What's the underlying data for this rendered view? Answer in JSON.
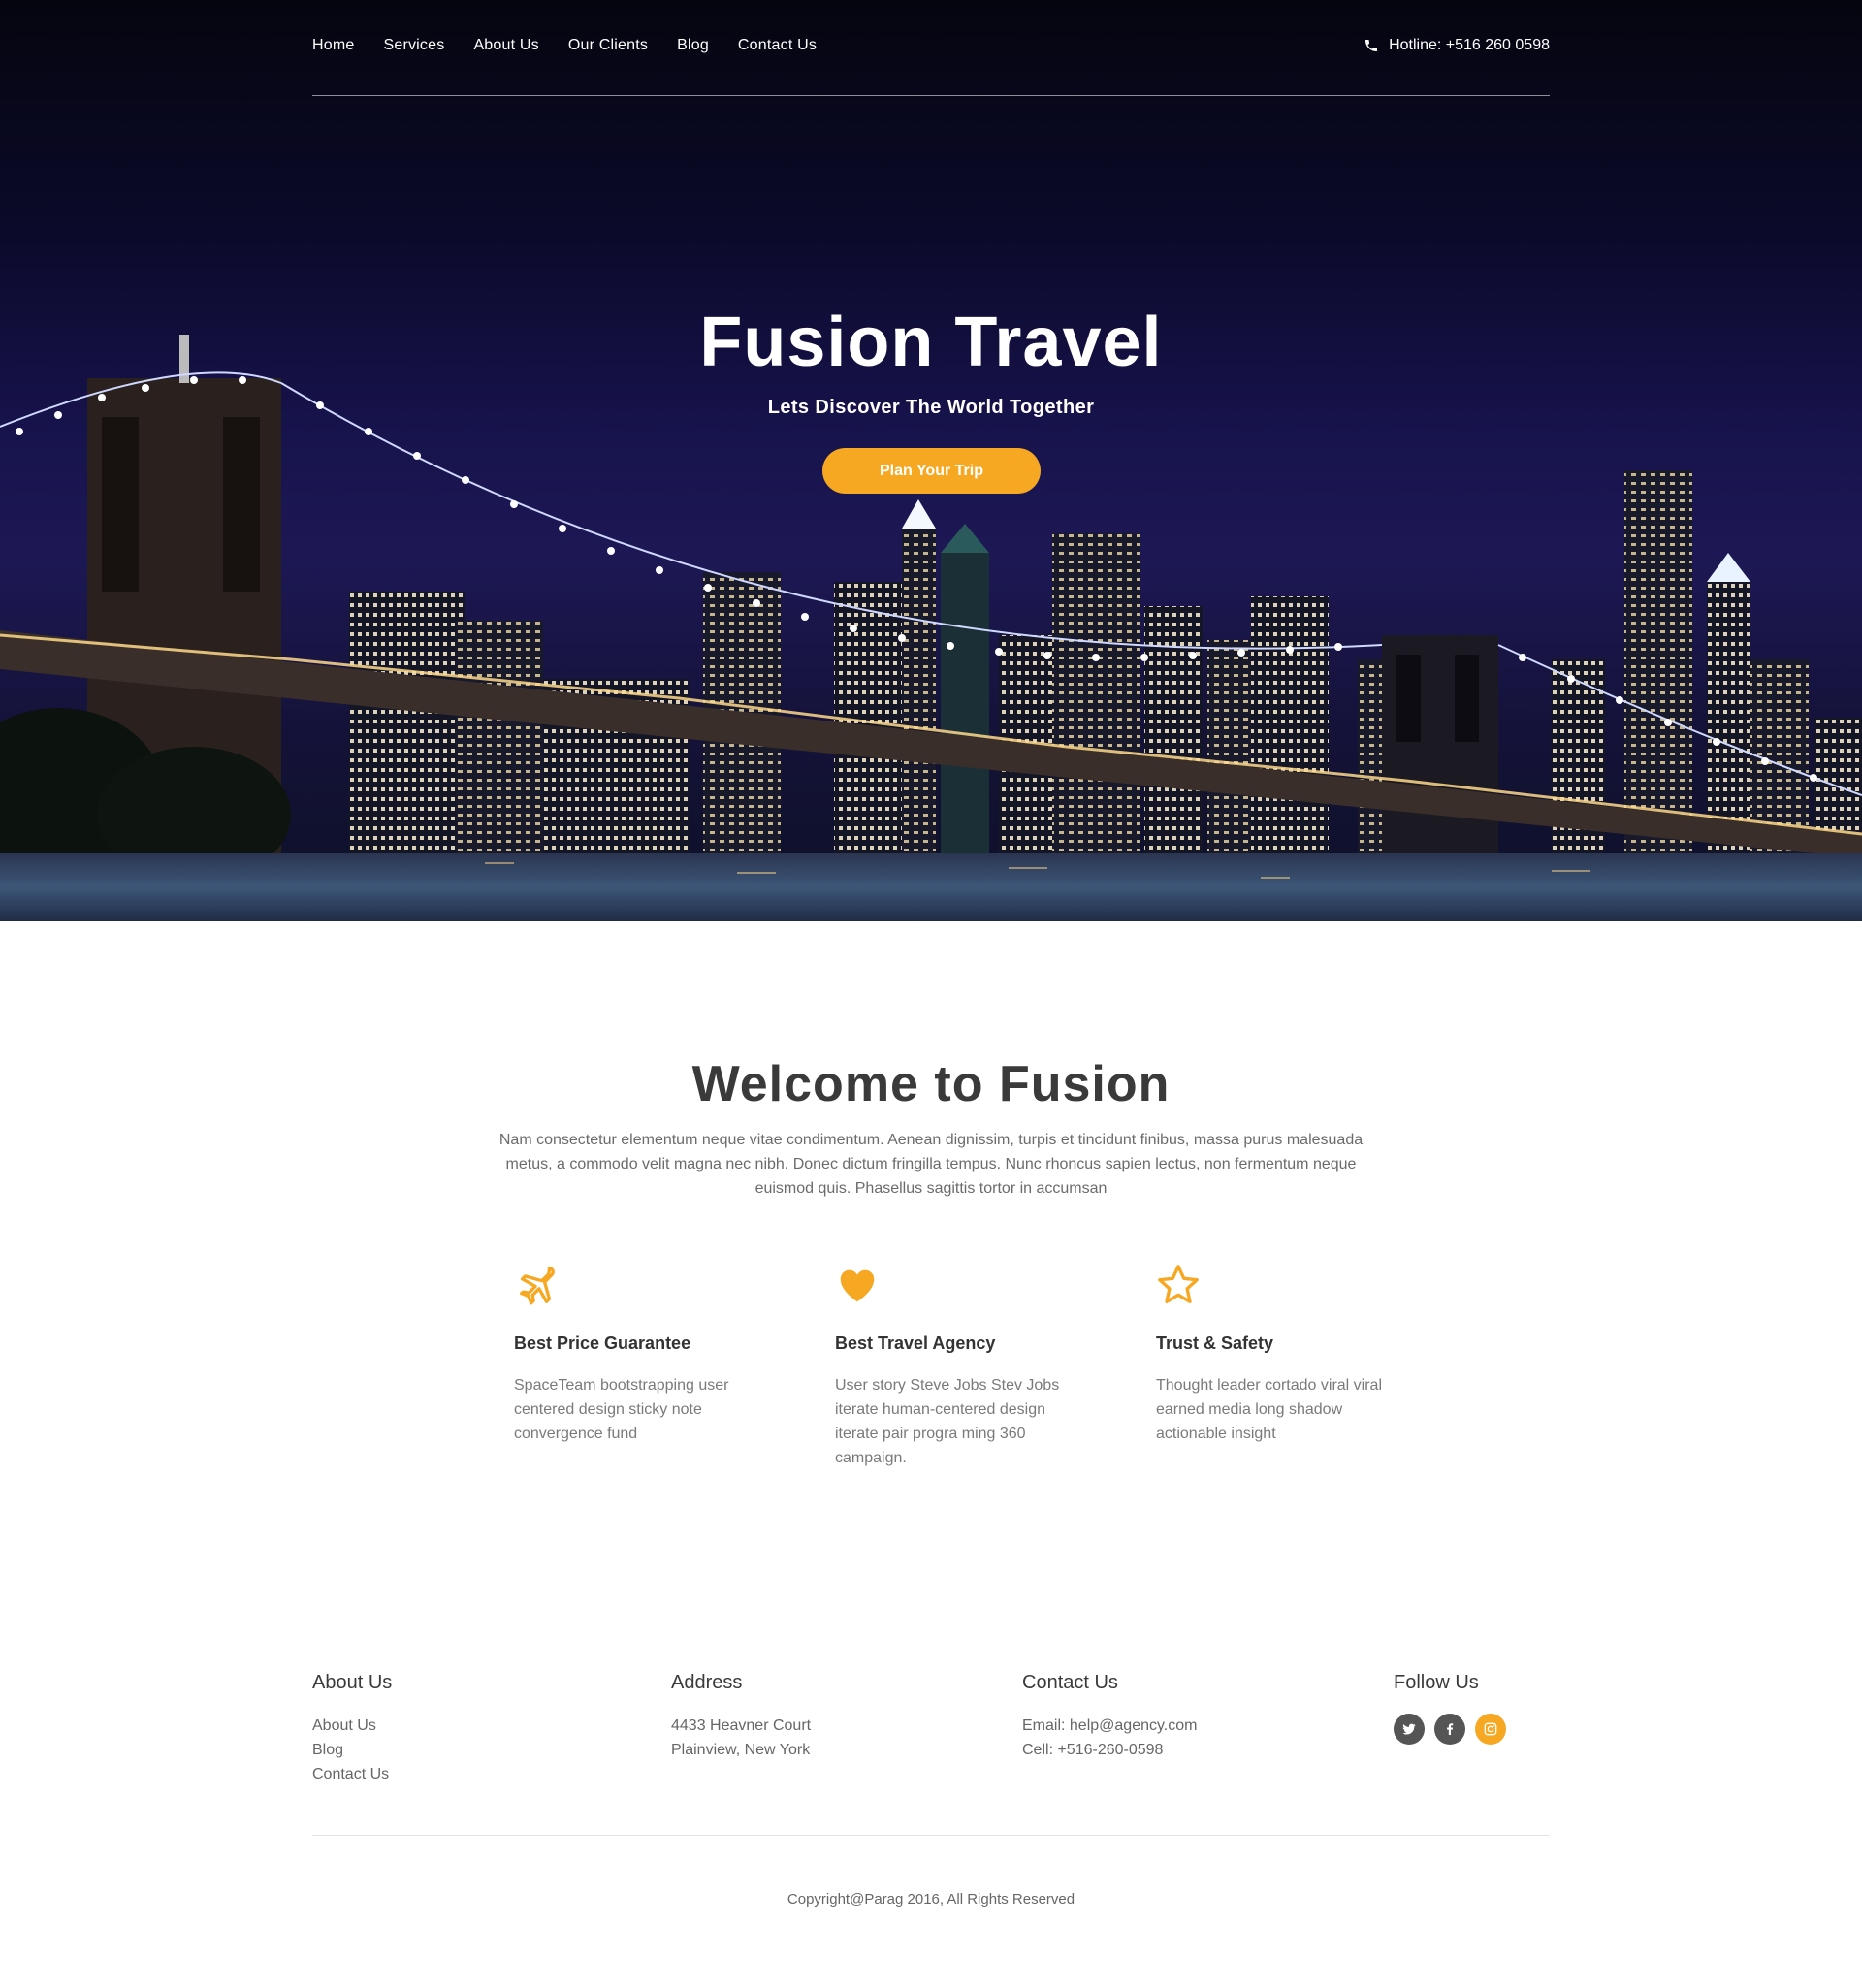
{
  "nav": {
    "items": [
      "Home",
      "Services",
      "About Us",
      "Our Clients",
      "Blog",
      "Contact Us"
    ],
    "hotline": "Hotline: +516 260 0598",
    "hotline_icon": "phone-icon"
  },
  "hero": {
    "title": "Fusion Travel",
    "subtitle": "Lets Discover The World Together",
    "cta": "Plan Your Trip"
  },
  "welcome": {
    "title": "Welcome to Fusion",
    "text": "Nam consectetur elementum neque vitae condimentum. Aenean dignissim, turpis et tincidunt finibus, massa purus malesuada metus, a commodo velit magna nec nibh. Donec dictum fringilla tempus. Nunc rhoncus sapien lectus, non fermentum neque euismod quis. Phasellus sagittis tortor in accumsan"
  },
  "features": [
    {
      "icon": "airplane-icon",
      "title": "Best Price Guarantee",
      "text": "SpaceTeam bootstrapping user centered design sticky note convergence fund"
    },
    {
      "icon": "heart-icon",
      "title": "Best Travel Agency",
      "text": "User story Steve Jobs Stev Jobs iterate human-centered design iterate pair progra ming 360 campaign."
    },
    {
      "icon": "star-icon",
      "title": "Trust & Safety",
      "text": "Thought leader cortado viral viral earned media long shadow actionable insight"
    }
  ],
  "footer": {
    "about": {
      "title": "About Us",
      "links": [
        "About Us",
        "Blog",
        "Contact Us"
      ]
    },
    "address": {
      "title": "Address",
      "lines": [
        "4433 Heavner Court",
        "Plainview, New York"
      ]
    },
    "contact": {
      "title": "Contact Us",
      "lines": [
        "Email: help@agency.com",
        "Cell: +516-260-0598"
      ]
    },
    "follow": {
      "title": "Follow Us",
      "icons": [
        "twitter-icon",
        "facebook-icon",
        "instagram-icon"
      ]
    },
    "copyright": "Copyright@Parag 2016, All Rights Reserved"
  },
  "colors": {
    "accent": "#f7a823",
    "social_bg": "#555555"
  }
}
